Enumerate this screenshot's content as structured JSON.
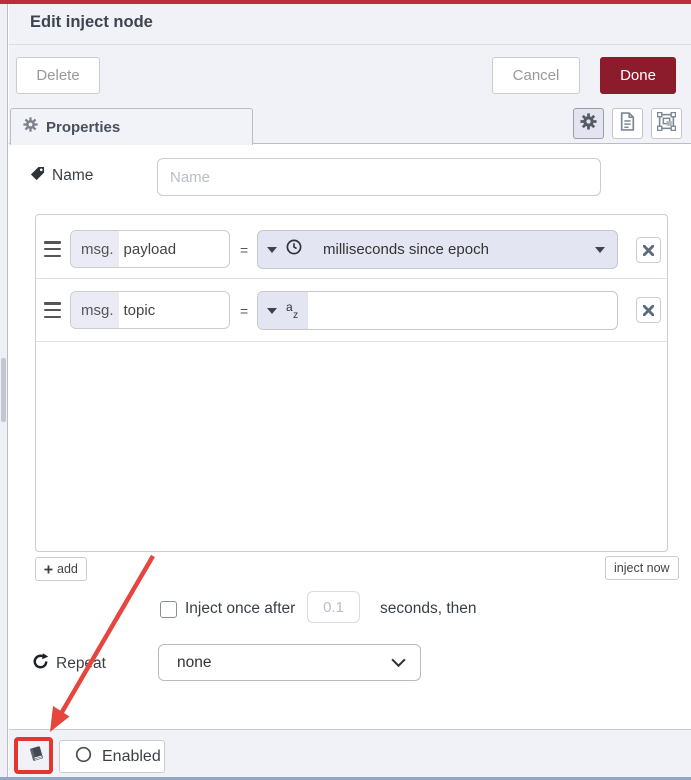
{
  "dialog": {
    "title": "Edit inject node"
  },
  "header": {
    "delete_label": "Delete",
    "cancel_label": "Cancel",
    "done_label": "Done"
  },
  "tabs": {
    "properties_label": "Properties"
  },
  "toolbar_icons": [
    {
      "name": "properties-gear-icon",
      "selected": true
    },
    {
      "name": "description-doc-icon",
      "selected": false
    },
    {
      "name": "appearance-icon",
      "selected": false
    }
  ],
  "name_field": {
    "label": "Name",
    "placeholder": "Name",
    "value": ""
  },
  "properties_list": {
    "rows": [
      {
        "prefix": "msg.",
        "property": "payload",
        "operator": "=",
        "type_icon": "timestamp-clock-icon",
        "value_label": "milliseconds since epoch"
      },
      {
        "prefix": "msg.",
        "property": "topic",
        "operator": "=",
        "type_icon": "string-az-icon",
        "value": ""
      }
    ],
    "az_icon": {
      "top": "a",
      "bottom": "z"
    },
    "add_label": "add",
    "inject_now_label": "inject now"
  },
  "inject_once": {
    "checked": false,
    "label": "Inject once after",
    "seconds_value": "0.1",
    "suffix_label": "seconds, then"
  },
  "repeat": {
    "label": "Repeat",
    "selected_option": "none"
  },
  "footer": {
    "enabled_label": "Enabled"
  },
  "colors": {
    "done_button_red": "#8C1B2B",
    "top_bar_red": "#BB2F3D",
    "annotation_red": "#E0372E",
    "field_lavender": "#E4E5F2",
    "header_lavender": "#F1F2F8"
  }
}
